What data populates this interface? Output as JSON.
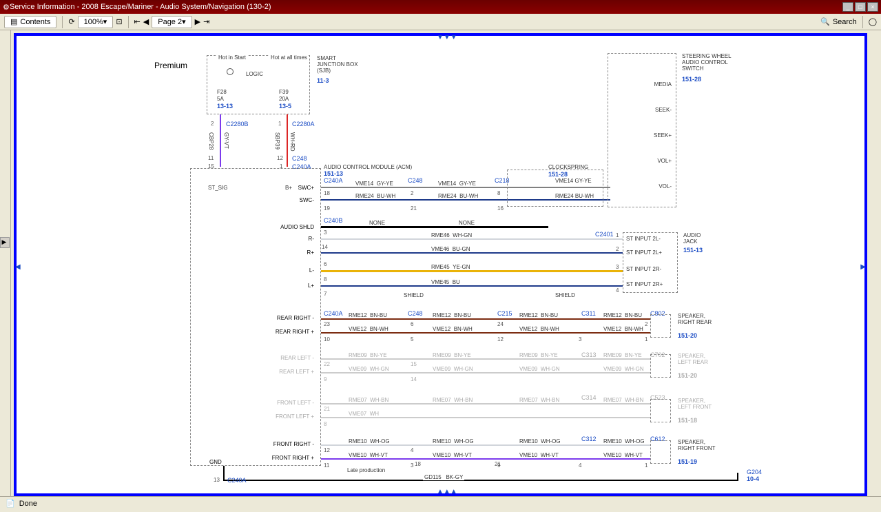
{
  "window": {
    "title": "Service Information - 2008 Escape/Mariner - Audio System/Navigation (130-2)"
  },
  "toolbar": {
    "contents": "Contents",
    "zoom": "100%",
    "page": "Page 2",
    "search": "Search"
  },
  "diagram": {
    "title": "Premium",
    "sjb": {
      "hot_start": "Hot in Start",
      "hot_all": "Hot at all times",
      "logic": "LOGIC",
      "f28": "F28",
      "f28_amp": "5A",
      "f28_ref": "13-13",
      "f39": "F39",
      "f39_amp": "20A",
      "f39_ref": "13-5",
      "label": "SMART JUNCTION BOX (SJB)",
      "ref": "11-3"
    },
    "conn_c2280b": "C2280B",
    "conn_c2280a": "C2280A",
    "wire_cbp28": "CBP28",
    "color_gyvt": "GY-VT",
    "wire_sbp39": "SBP39",
    "color_whrd": "WH-RD",
    "conn_c248": "C248",
    "conn_c240a": "C240A",
    "acm": {
      "label": "AUDIO CONTROL MODULE (ACM)",
      "ref": "151-13",
      "st_sig": "ST_SIG",
      "bplus": "B+",
      "swc_p": "SWC+",
      "swc_n": "SWC-",
      "shld": "AUDIO SHLD",
      "r_n": "R-",
      "r_p": "R+",
      "l_n": "L-",
      "l_p": "L+",
      "rr_n": "REAR RIGHT -",
      "rr_p": "REAR RIGHT +",
      "rl_n": "REAR LEFT -",
      "rl_p": "REAR LEFT +",
      "fl_n": "FRONT LEFT -",
      "fl_p": "FRONT LEFT +",
      "fr_n": "FRONT RIGHT -",
      "fr_p": "FRONT RIGHT +",
      "gnd": "GND"
    },
    "wires": {
      "vme14": "VME14",
      "gyye": "GY-YE",
      "rme24": "RME24",
      "buwh": "BU-WH",
      "none": "NONE",
      "rme46": "RME46",
      "whgn": "WH-GN",
      "vme46": "VME46",
      "bugn": "BU-GN",
      "rme45": "RME45",
      "yegn": "YE-GN",
      "vme45": "VME45",
      "bu": "BU",
      "shield": "SHIELD",
      "rme12": "RME12",
      "bnbu": "BN-BU",
      "vme12": "VME12",
      "bnwh": "BN-WH",
      "rme09": "RME09",
      "bnye": "BN-YE",
      "vme09": "VME09",
      "rme07": "RME07",
      "whbn": "WH-BN",
      "vme07": "VME07",
      "wh": "WH",
      "rme10": "RME10",
      "whog": "WH-OG",
      "vme10": "VME10",
      "whvt": "WH-VT",
      "gd115": "GD115",
      "bkgy": "BK-GY"
    },
    "clockspring": {
      "label": "CLOCKSPRING",
      "ref": "151-28"
    },
    "steering": {
      "label": "STEERING WHEEL AUDIO CONTROL SWITCH",
      "ref": "151-28",
      "media": "MEDIA",
      "seek_n": "SEEK-",
      "seek_p": "SEEK+",
      "vol_p": "VOL+",
      "vol_n": "VOL-"
    },
    "jack": {
      "label": "AUDIO JACK",
      "ref": "151-13",
      "in2l_n": "ST INPUT 2L-",
      "in2l_p": "ST INPUT 2L+",
      "in2r_n": "ST INPUT 2R-",
      "in2r_p": "ST INPUT 2R+"
    },
    "spk_rr": {
      "label": "SPEAKER, RIGHT REAR",
      "ref": "151-20"
    },
    "spk_lr": {
      "label": "SPEAKER, LEFT REAR",
      "ref": "151-20"
    },
    "spk_lf": {
      "label": "SPEAKER, LEFT FRONT",
      "ref": "151-18"
    },
    "spk_rf": {
      "label": "SPEAKER, RIGHT FRONT",
      "ref": "151-19"
    },
    "late": "Late production",
    "g204": "G204",
    "g204_ref": "10-4",
    "conn": {
      "c240b": "C240B",
      "c218": "C218",
      "c215": "C215",
      "c311": "C311",
      "c802": "C802",
      "c313": "C313",
      "c702": "C702",
      "c314": "C314",
      "c523": "C523",
      "c312": "C312",
      "c612": "C612",
      "c2401": "C2401"
    },
    "pins": {
      "p1": "1",
      "p2": "2",
      "p3": "3",
      "p4": "4",
      "p5": "5",
      "p6": "6",
      "p7": "7",
      "p8": "8",
      "p9": "9",
      "p10": "10",
      "p11": "11",
      "p12": "12",
      "p13": "13",
      "p14": "14",
      "p15": "15",
      "p16": "16",
      "p18": "18",
      "p19": "19",
      "p21": "21",
      "p22": "22",
      "p23": "23",
      "p24": "24"
    }
  },
  "status": {
    "done": "Done"
  }
}
